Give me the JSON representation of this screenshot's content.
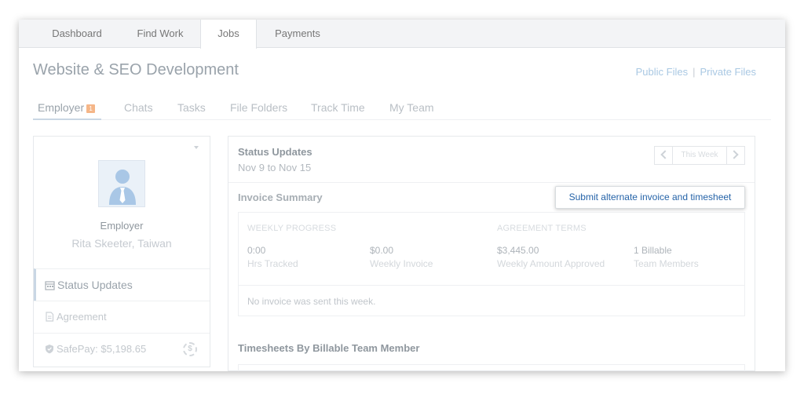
{
  "nav": {
    "tabs": [
      {
        "label": "Dashboard"
      },
      {
        "label": "Find Work"
      },
      {
        "label": "Jobs"
      },
      {
        "label": "Payments"
      }
    ],
    "active": "Jobs"
  },
  "job": {
    "title": "Website & SEO Development",
    "public_files": "Public Files",
    "separator": "|",
    "private_files": "Private Files"
  },
  "subtabs": {
    "items": [
      {
        "label": "Employer"
      },
      {
        "label": "Chats"
      },
      {
        "label": "Tasks"
      },
      {
        "label": "File Folders"
      },
      {
        "label": "Track Time"
      },
      {
        "label": "My Team"
      }
    ],
    "employer_badge": "1"
  },
  "employer_panel": {
    "role": "Employer",
    "name": "Rita Skeeter, Taiwan",
    "menu": [
      {
        "label": "Status Updates",
        "icon": "calendar-icon"
      },
      {
        "label": "Agreement",
        "icon": "document-icon"
      },
      {
        "label": "SafePay: $5,198.65",
        "icon": "shield-icon"
      }
    ],
    "safepay_icon_glyph": "$"
  },
  "status": {
    "title": "Status Updates",
    "date_range": "Nov 9 to Nov 15",
    "week_label": "This Week"
  },
  "invoice": {
    "title": "Invoice Summary",
    "submit_label": "Submit alternate invoice and timesheet",
    "weekly_progress_heading": "WEEKLY PROGRESS",
    "agreement_terms_heading": "AGREEMENT TERMS",
    "stats": [
      {
        "value": "0:00",
        "caption": "Hrs Tracked"
      },
      {
        "value": "$0.00",
        "caption": "Weekly Invoice"
      },
      {
        "value": "$3,445.00",
        "caption": "Weekly Amount Approved"
      },
      {
        "value": "1 Billable",
        "caption": "Team Members"
      }
    ],
    "note": "No invoice was sent this week."
  },
  "timesheets": {
    "title": "Timesheets By Billable Team Member"
  },
  "colors": {
    "accent_link": "#2563a8",
    "muted_link": "#a9c8e3",
    "badge": "#f5b688"
  }
}
